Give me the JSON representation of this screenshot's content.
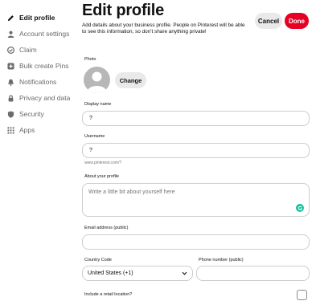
{
  "sidebar": {
    "items": [
      {
        "label": "Edit profile",
        "icon": "pencil-icon",
        "active": true
      },
      {
        "label": "Account settings",
        "icon": "person-icon",
        "active": false
      },
      {
        "label": "Claim",
        "icon": "claim-icon",
        "active": false
      },
      {
        "label": "Bulk create Pins",
        "icon": "plus-box-icon",
        "active": false
      },
      {
        "label": "Notifications",
        "icon": "bell-icon",
        "active": false
      },
      {
        "label": "Privacy and data",
        "icon": "lock-icon",
        "active": false
      },
      {
        "label": "Security",
        "icon": "shield-icon",
        "active": false
      },
      {
        "label": "Apps",
        "icon": "grid-icon",
        "active": false
      }
    ]
  },
  "header": {
    "title": "Edit profile",
    "intro": "Add details about your business profile. People on Pinterest will be able to see this information, so don't share anything private!",
    "cancel_label": "Cancel",
    "done_label": "Done"
  },
  "form": {
    "photo_label": "Photo",
    "change_label": "Change",
    "display_name_label": "Display name",
    "display_name_value": "?",
    "username_label": "Username",
    "username_value": "?",
    "username_hint": "www.pinterest.com/?",
    "about_label": "About your profile",
    "about_placeholder": "Write a little bit about yourself here",
    "email_label": "Email address (public)",
    "email_value": "",
    "country_label": "Country Code",
    "country_value": "United States (+1)",
    "phone_label": "Phone number (public)",
    "phone_value": "",
    "retail_label": "Include a retail location?",
    "retail_checked": false
  },
  "colors": {
    "accent": "#e60023",
    "grammarly": "#15c39a"
  }
}
